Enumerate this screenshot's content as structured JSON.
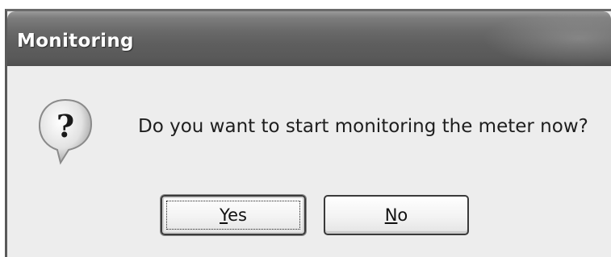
{
  "window": {
    "title": "Monitoring"
  },
  "dialog": {
    "icon": "question-icon",
    "message": "Do you want to start monitoring the meter now?"
  },
  "buttons": {
    "yes": {
      "mnemonic": "Y",
      "rest": "es"
    },
    "no": {
      "mnemonic": "N",
      "rest": "o"
    }
  }
}
